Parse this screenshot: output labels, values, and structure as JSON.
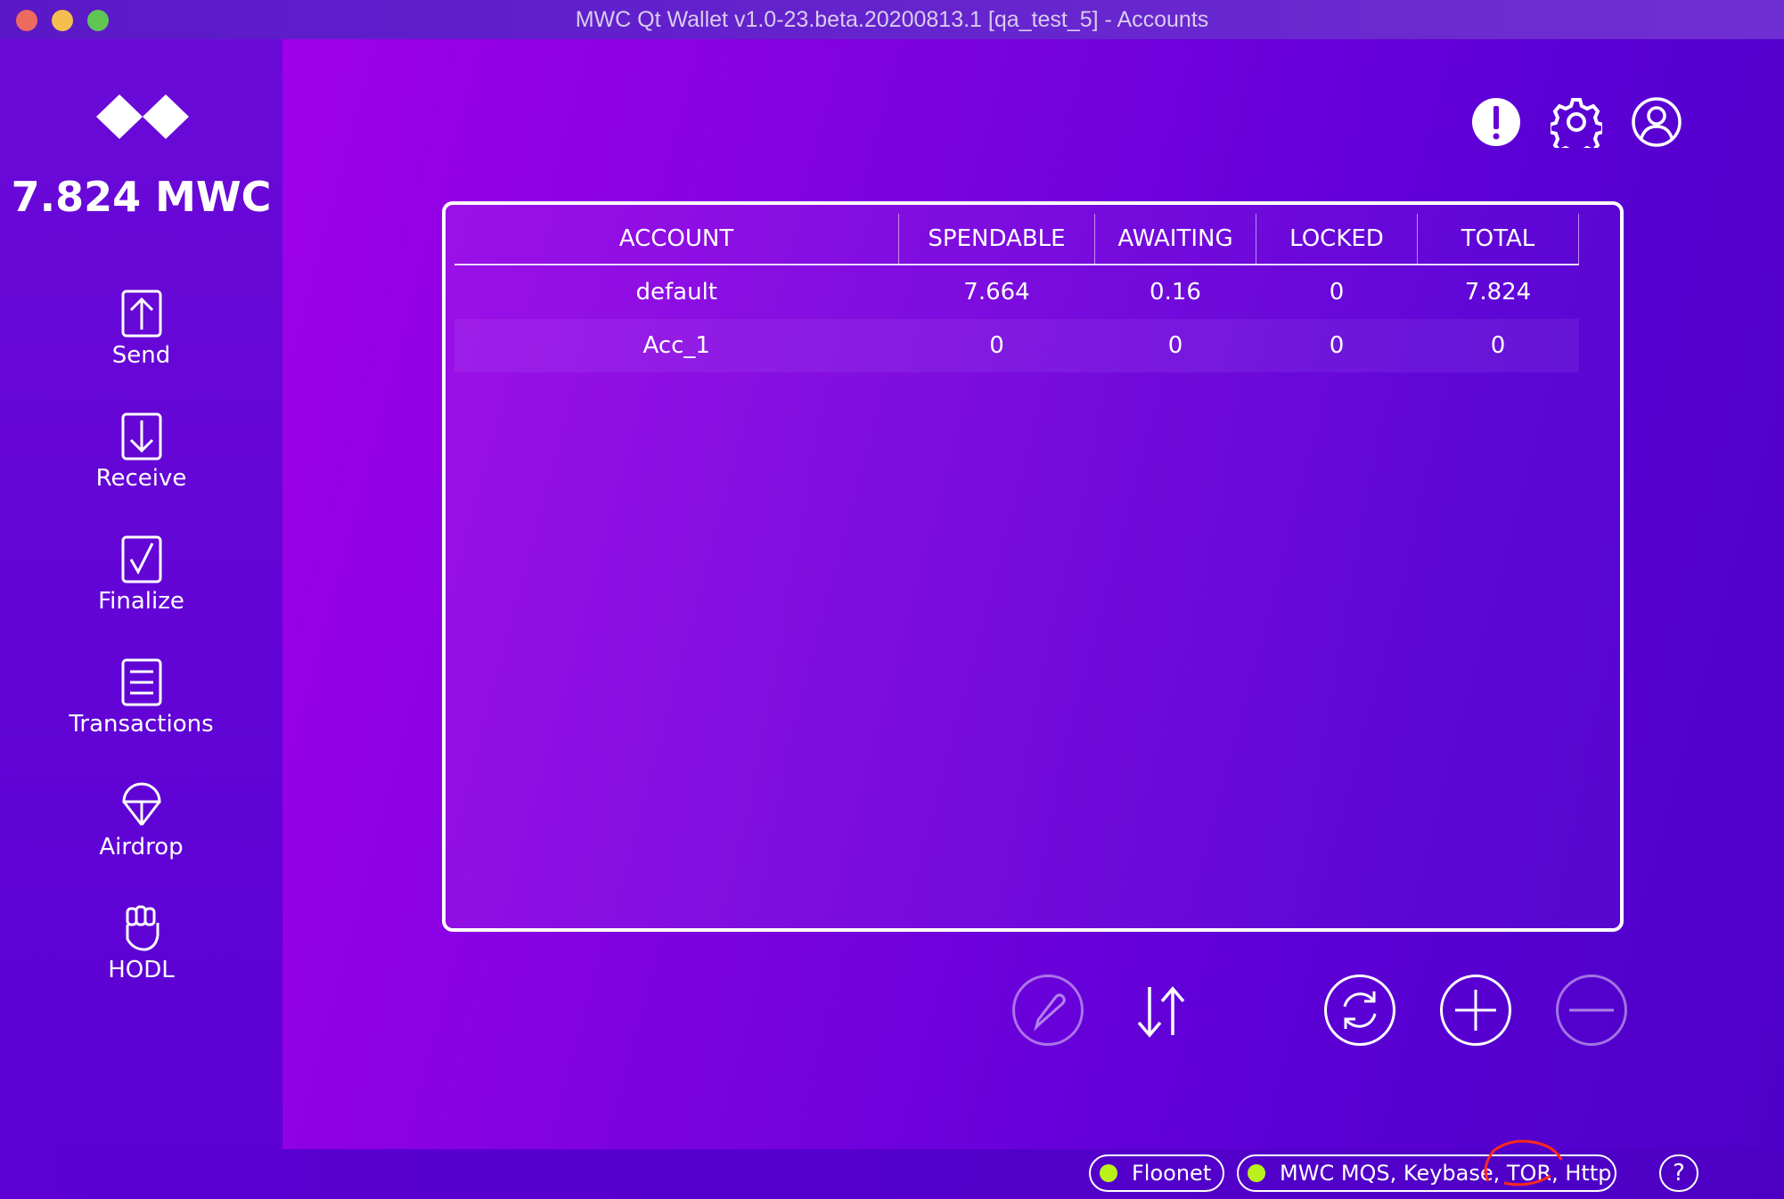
{
  "window": {
    "title": "MWC Qt Wallet v1.0-23.beta.20200813.1 [qa_test_5] - Accounts"
  },
  "sidebar": {
    "balance": "7.824 MWC",
    "items": [
      {
        "label": "Send",
        "icon": "send-icon"
      },
      {
        "label": "Receive",
        "icon": "receive-icon"
      },
      {
        "label": "Finalize",
        "icon": "finalize-icon"
      },
      {
        "label": "Transactions",
        "icon": "transactions-icon"
      },
      {
        "label": "Airdrop",
        "icon": "airdrop-icon"
      },
      {
        "label": "HODL",
        "icon": "hodl-icon"
      }
    ]
  },
  "header": {
    "icons": [
      "notification-icon",
      "settings-icon",
      "account-icon"
    ]
  },
  "accounts_table": {
    "columns": [
      "ACCOUNT",
      "SPENDABLE",
      "AWAITING",
      "LOCKED",
      "TOTAL"
    ],
    "rows": [
      {
        "account": "default",
        "spendable": "7.664",
        "awaiting": "0.16",
        "locked": "0",
        "total": "7.824"
      },
      {
        "account": "Acc_1",
        "spendable": "0",
        "awaiting": "0",
        "locked": "0",
        "total": "0"
      }
    ]
  },
  "actions": {
    "buttons": [
      "rename-icon",
      "transfer-icon",
      "refresh-icon",
      "add-icon",
      "remove-icon"
    ]
  },
  "status_bar": {
    "network": "Floonet",
    "connections": "MWC MQS, Keybase, TOR, Http",
    "help": "?",
    "status_color": "#b9f21a"
  }
}
